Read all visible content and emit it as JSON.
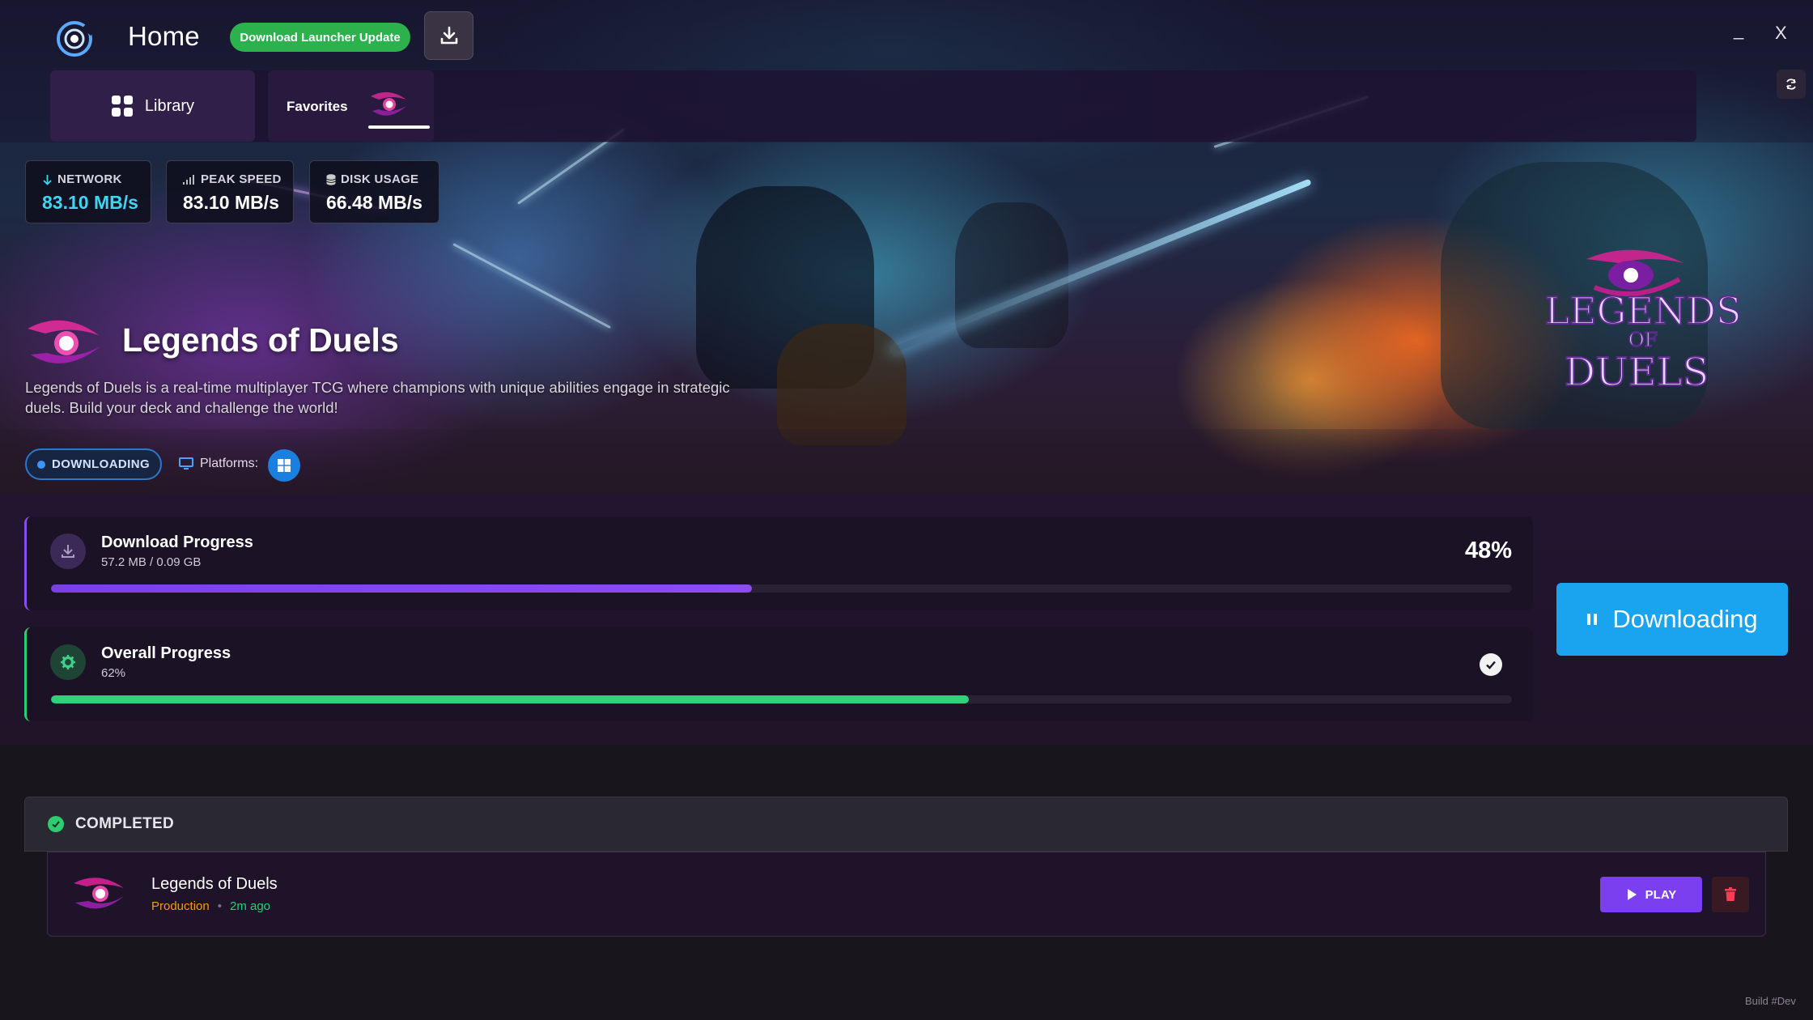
{
  "window": {
    "title": "Home",
    "update_button": "Download Launcher Update",
    "minimize": "_",
    "close": "X"
  },
  "tabs": {
    "library": "Library",
    "favorites": "Favorites"
  },
  "stats": [
    {
      "label": "NETWORK",
      "value": "83.10 MB/s",
      "icon": "arrow-down-icon"
    },
    {
      "label": "PEAK SPEED",
      "value": "83.10 MB/s",
      "icon": "signal-bars-icon"
    },
    {
      "label": "DISK USAGE",
      "value": "66.48 MB/s",
      "icon": "database-icon"
    }
  ],
  "game": {
    "title": "Legends of Duels",
    "description": "Legends of Duels is a real-time multiplayer TCG where champions with unique abilities engage in strategic duels. Build your deck and challenge the world!",
    "logo_line1": "LEGENDS",
    "logo_line2": "OF",
    "logo_line3": "DUELS",
    "status": "DOWNLOADING",
    "platforms_label": "Platforms:"
  },
  "download_progress": {
    "title": "Download Progress",
    "detail": "57.2 MB / 0.09 GB",
    "percent_label": "48%",
    "fraction": 0.48
  },
  "overall_progress": {
    "title": "Overall Progress",
    "detail": "62%",
    "fraction": 0.628
  },
  "action_button": "Downloading",
  "completed": {
    "header": "COMPLETED",
    "items": [
      {
        "name": "Legends of Duels",
        "environment": "Production",
        "separator": "•",
        "time": "2m ago",
        "play": "PLAY"
      }
    ]
  },
  "footer": {
    "build": "Build #Dev"
  },
  "colors": {
    "accent_purple": "#8a4cf0",
    "accent_green": "#2ecc71",
    "accent_blue": "#1aa3ee",
    "update_green": "#2bb24c"
  }
}
